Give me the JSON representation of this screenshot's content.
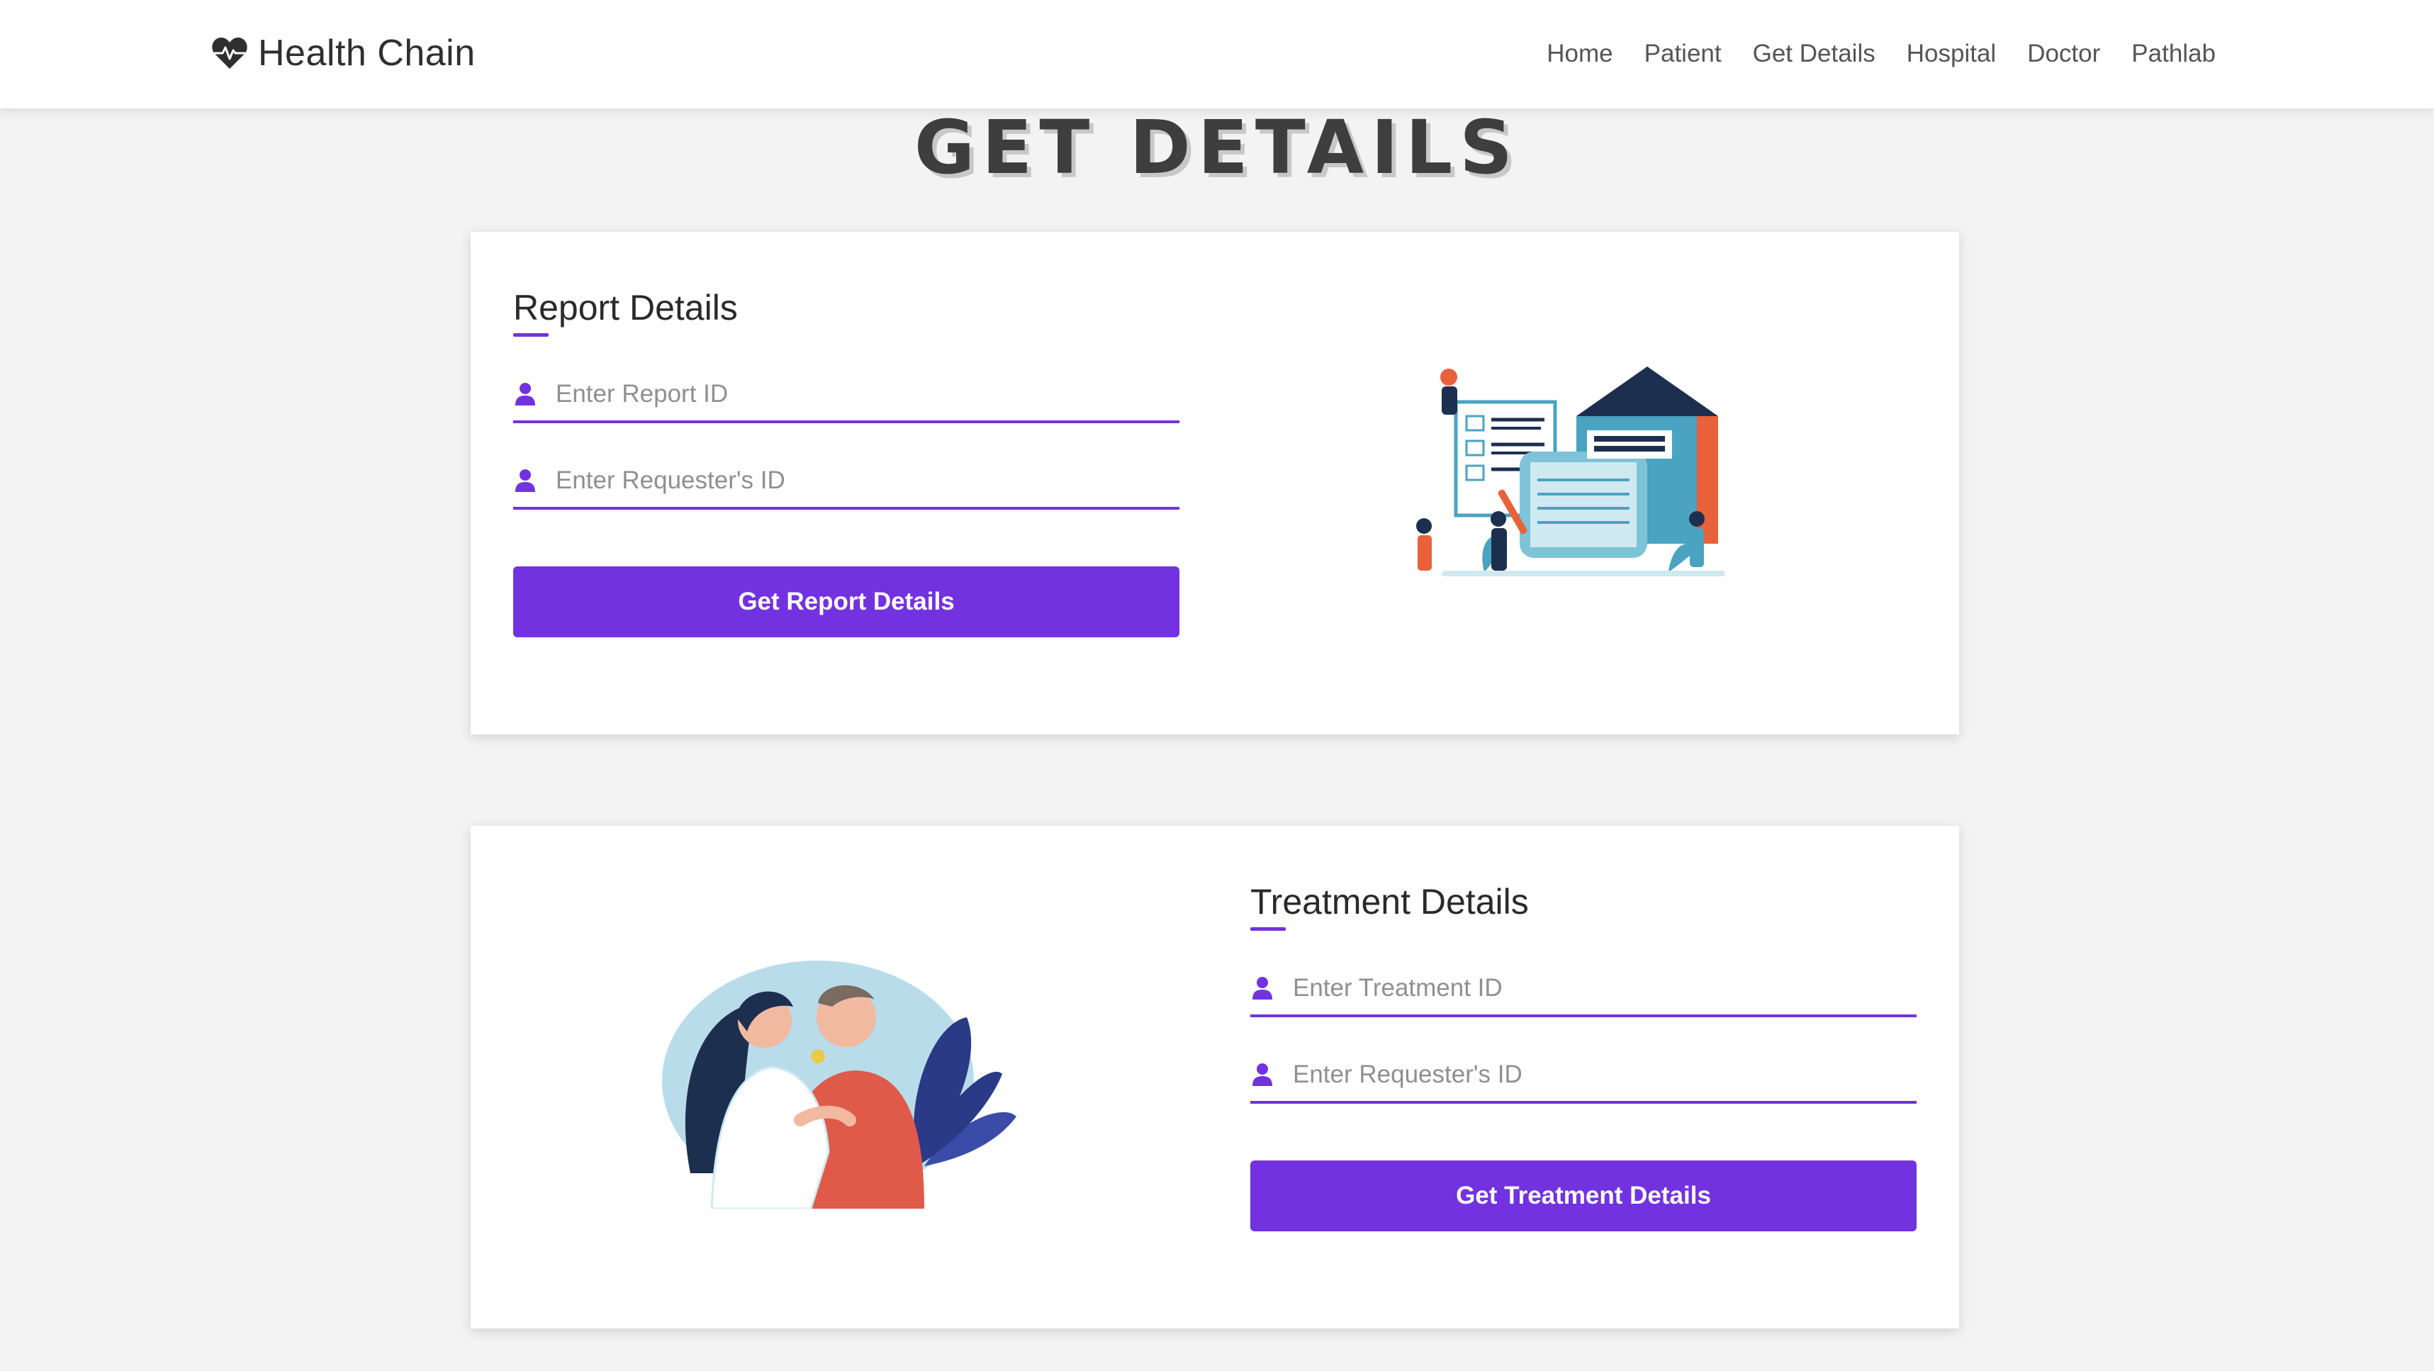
{
  "navbar": {
    "brand": "Health Chain",
    "links": [
      "Home",
      "Patient",
      "Get Details",
      "Hospital",
      "Doctor",
      "Pathlab"
    ]
  },
  "page": {
    "title": "GET DETAILS"
  },
  "report_form": {
    "title": "Report Details",
    "report_id_placeholder": "Enter Report ID",
    "requester_id_placeholder": "Enter Requester's ID",
    "report_id_value": "",
    "requester_id_value": "",
    "button_label": "Get Report Details"
  },
  "treatment_form": {
    "title": "Treatment Details",
    "treatment_id_placeholder": "Enter Treatment ID",
    "requester_id_placeholder": "Enter Requester's ID",
    "treatment_id_value": "",
    "requester_id_value": "",
    "button_label": "Get Treatment Details"
  },
  "colors": {
    "accent": "#7232df",
    "background": "#f3f3f3",
    "card": "#ffffff"
  },
  "icons": {
    "brand": "heartbeat-icon",
    "field": "user-icon"
  }
}
